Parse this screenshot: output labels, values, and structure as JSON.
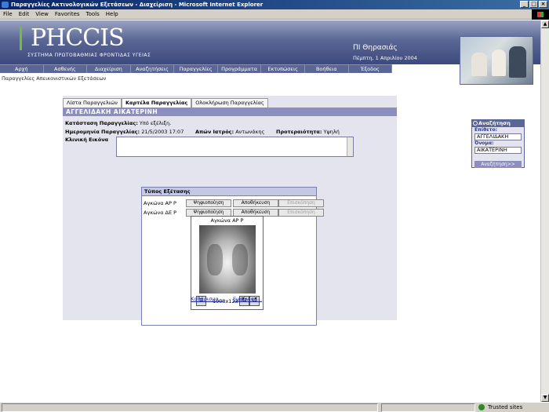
{
  "window": {
    "title": "Παραγγελίες Ακτινολογικών Εξετάσεων - Διαχείριση - Microsoft Internet Explorer"
  },
  "menubar": [
    "File",
    "Edit",
    "View",
    "Favorites",
    "Tools",
    "Help"
  ],
  "header": {
    "logo": "PHCCIS",
    "logo_sub": "ΣΥΣΤΗΜΑ ΠΡΩΤΟΒΑΘΜΙΑΣ ΦΡΟΝΤΙΔΑΣ ΥΓΕΙΑΣ",
    "hospital": "ΠΙ Θηρασιάς",
    "date": "Πέμπτη, 1 Απριλίου 2004"
  },
  "nav": [
    "Αρχή",
    "Ασθενής",
    "Διαχείριση",
    "Αναζητήσεις",
    "Παραγγελίες",
    "Προγράμματα",
    "Εκτυπώσεις",
    "Βοήθεια",
    "Έξοδος"
  ],
  "breadcrumb": "Παραγγελίες Απεικονιστικών Εξετάσεων",
  "tabs": [
    "Λίστα Παραγγελιών",
    "Καρτέλα Παραγγελίας",
    "Ολοκλήρωση Παραγγελίας"
  ],
  "patient_name": "ΑΓΓΕΛΙΔΑΚΗ   ΑΙΚΑΤΕΡΙΝΗ",
  "order": {
    "status_label": "Κατάσταση Παραγγελίας:",
    "status_value": "Υπό εξέλιξη.",
    "date_label": "Ημερομηνία Παραγγελίας:",
    "date_value": "21/5/2003 17:07",
    "doctor_label": "Απών Ιατρός:",
    "doctor_value": "Αντωνάκης",
    "priority_label": "Προτεραιότητα:",
    "priority_value": "Υψηλή",
    "clinical_label": "Κλινική Εικόνα"
  },
  "exams": {
    "header": "Τύπος Εξέτασης",
    "rows": [
      {
        "label": "Αγκώνα ΑΡ Ρ"
      },
      {
        "label": "Αγκώνα ΔΕ Ρ"
      }
    ],
    "buttons": [
      "Ψηφιοποίηση",
      "Αποθήκευση",
      "Επισκόπηση"
    ]
  },
  "viewer": {
    "title": "Αγκώνα ΑΡ Ρ",
    "dimensions": "1008x1237",
    "clear_link": "Καθάρισμα...",
    "display_link": "Εμφάνιση..."
  },
  "search": {
    "header": "Αναζήτηση",
    "surname_label": "Επίθετο:",
    "surname_value": "ΑΓΓΕΛΙΔΑΚΗ",
    "name_label": "Όνομα:",
    "name_value": "ΑΙΚΑΤΕΡΙΝΗ",
    "button": "Αναζήτηση>>"
  },
  "status": {
    "zone": "Trusted sites"
  }
}
